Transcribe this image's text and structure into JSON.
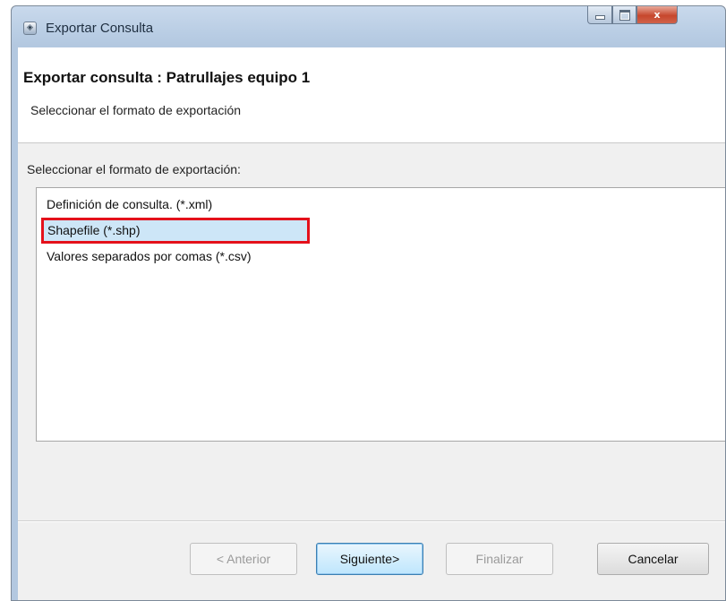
{
  "window": {
    "title": "Exportar Consulta",
    "close_glyph": "x"
  },
  "header": {
    "title": "Exportar consulta : Patrullajes equipo 1",
    "subtitle": "Seleccionar el formato de exportación"
  },
  "main": {
    "prompt": "Seleccionar el formato de exportación:",
    "formats": [
      {
        "label": "Definición de consulta.  (*.xml)",
        "selected": false
      },
      {
        "label": "Shapefile (*.shp)",
        "selected": true
      },
      {
        "label": "Valores separados por comas  (*.csv)",
        "selected": false
      }
    ]
  },
  "buttons": {
    "back": "< Anterior",
    "next": "Siguiente>",
    "finish": "Finalizar",
    "cancel": "Cancelar"
  },
  "colors": {
    "selection_highlight": "#cde6f7",
    "annotation_border": "#e4111b"
  },
  "icons": {
    "app": "app-icon",
    "minimize": "minimize-icon",
    "maximize": "maximize-icon",
    "close": "close-icon"
  }
}
